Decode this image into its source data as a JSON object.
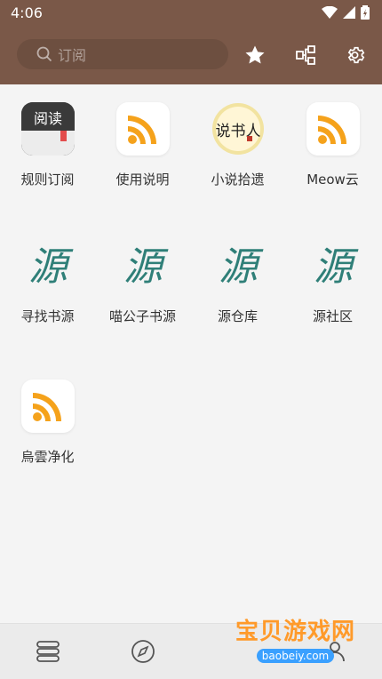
{
  "status": {
    "time": "4:06"
  },
  "toolbar": {
    "search_placeholder": "订阅"
  },
  "items": [
    {
      "label": "规则订阅",
      "icon": "read-app-icon",
      "icon_text": "阅读"
    },
    {
      "label": "使用说明",
      "icon": "rss-icon"
    },
    {
      "label": "小说拾遗",
      "icon": "shuoshu-logo-icon",
      "icon_text": "说书人"
    },
    {
      "label": "Meow云",
      "icon": "rss-icon"
    },
    {
      "label": "寻找书源",
      "icon": "yuan-calligraphy-icon",
      "icon_text": "源"
    },
    {
      "label": "喵公子书源",
      "icon": "yuan-calligraphy-icon",
      "icon_text": "源"
    },
    {
      "label": "源仓库",
      "icon": "yuan-calligraphy-icon",
      "icon_text": "源"
    },
    {
      "label": "源社区",
      "icon": "yuan-calligraphy-icon",
      "icon_text": "源"
    },
    {
      "label": "烏雲净化",
      "icon": "rss-icon"
    }
  ],
  "watermark": {
    "title": "宝贝游戏网",
    "url": "baobeiy.com"
  },
  "colors": {
    "toolbar": "#7a5848",
    "rss": "#f5a21b",
    "accent_green": "#2f7f78"
  }
}
